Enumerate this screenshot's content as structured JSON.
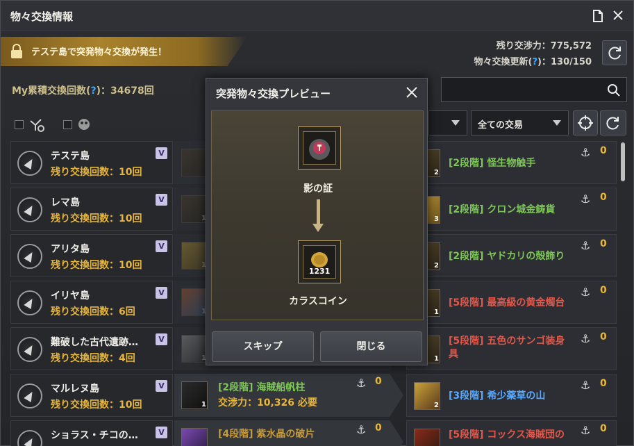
{
  "window": {
    "title": "物々交換情報"
  },
  "banner": {
    "text": "テステ島で突発物々交換が発生！"
  },
  "header": {
    "remaining_power_label": "残り交渉力：775,572",
    "refresh_label_prefix": "物々交換更新(",
    "refresh_q": "?",
    "refresh_label_suffix": ")：130/150"
  },
  "my_count": {
    "prefix": "My累積交換回数(",
    "q": "?",
    "suffix": ")：34678回"
  },
  "filters": {
    "dropdown_all_trades": "全ての交易"
  },
  "rows": [
    {
      "island": "テステ島",
      "remain": "残り交換回数：10回",
      "badge": "V",
      "give_cnt": "",
      "get_name": "[2段階] 怪生物触手",
      "get_cnt": "2",
      "zero1": "0",
      "zero2": "0"
    },
    {
      "island": "レマ島",
      "remain": "残り交換回数：10回",
      "badge": "V",
      "give_cnt": "1",
      "get_name": "[2段階] クロン城金鋳貨",
      "get_cnt": "3",
      "zero1": "0",
      "zero2": "0"
    },
    {
      "island": "アリタ島",
      "remain": "残り交換回数：10回",
      "badge": "V",
      "give_cnt": "1",
      "get_name": "[2段階] ヤドカリの殻飾り",
      "get_cnt": "2",
      "zero1": "0",
      "zero2": "0"
    },
    {
      "island": "イリヤ島",
      "remain": "残り交換回数：6回",
      "badge": "V",
      "give_cnt": "1",
      "get_name": "[5段階] 最高級の黄金燭台",
      "get_cnt": "1",
      "zero1": "0",
      "zero2": "0"
    },
    {
      "island": "難破した古代遺跡…",
      "remain": "残り交換回数：4回",
      "badge": "V",
      "give_cnt": "1",
      "get_name": "[5段階] 五色のサンゴ装身具",
      "get_cnt": "1",
      "zero1": "0",
      "zero2": "0"
    },
    {
      "island": "マルレヌ島",
      "remain": "残り交換回数：10回",
      "badge": "V",
      "give_name": "[2段階] 海賊船帆柱",
      "give_cost": "交渉力：10,326 必要",
      "give_cnt": "1",
      "get_name": "[3段階] 希少薬草の山",
      "get_cnt": "2",
      "zero1": "0",
      "zero2": "0"
    },
    {
      "island": "ショラス・チコの…",
      "remain": "",
      "badge": "V",
      "give_name": "[4段階] 紫水晶の破片",
      "give_cnt": "",
      "get_name": "[5段階] コックス海賊団の",
      "get_cnt": "",
      "zero1": "0",
      "zero2": "0"
    }
  ],
  "modal": {
    "title": "突発物々交換プレビュー",
    "from_item": "影の証",
    "to_item": "カラスコイン",
    "to_count": "1231",
    "skip_label": "スキップ",
    "close_label": "閉じる"
  }
}
